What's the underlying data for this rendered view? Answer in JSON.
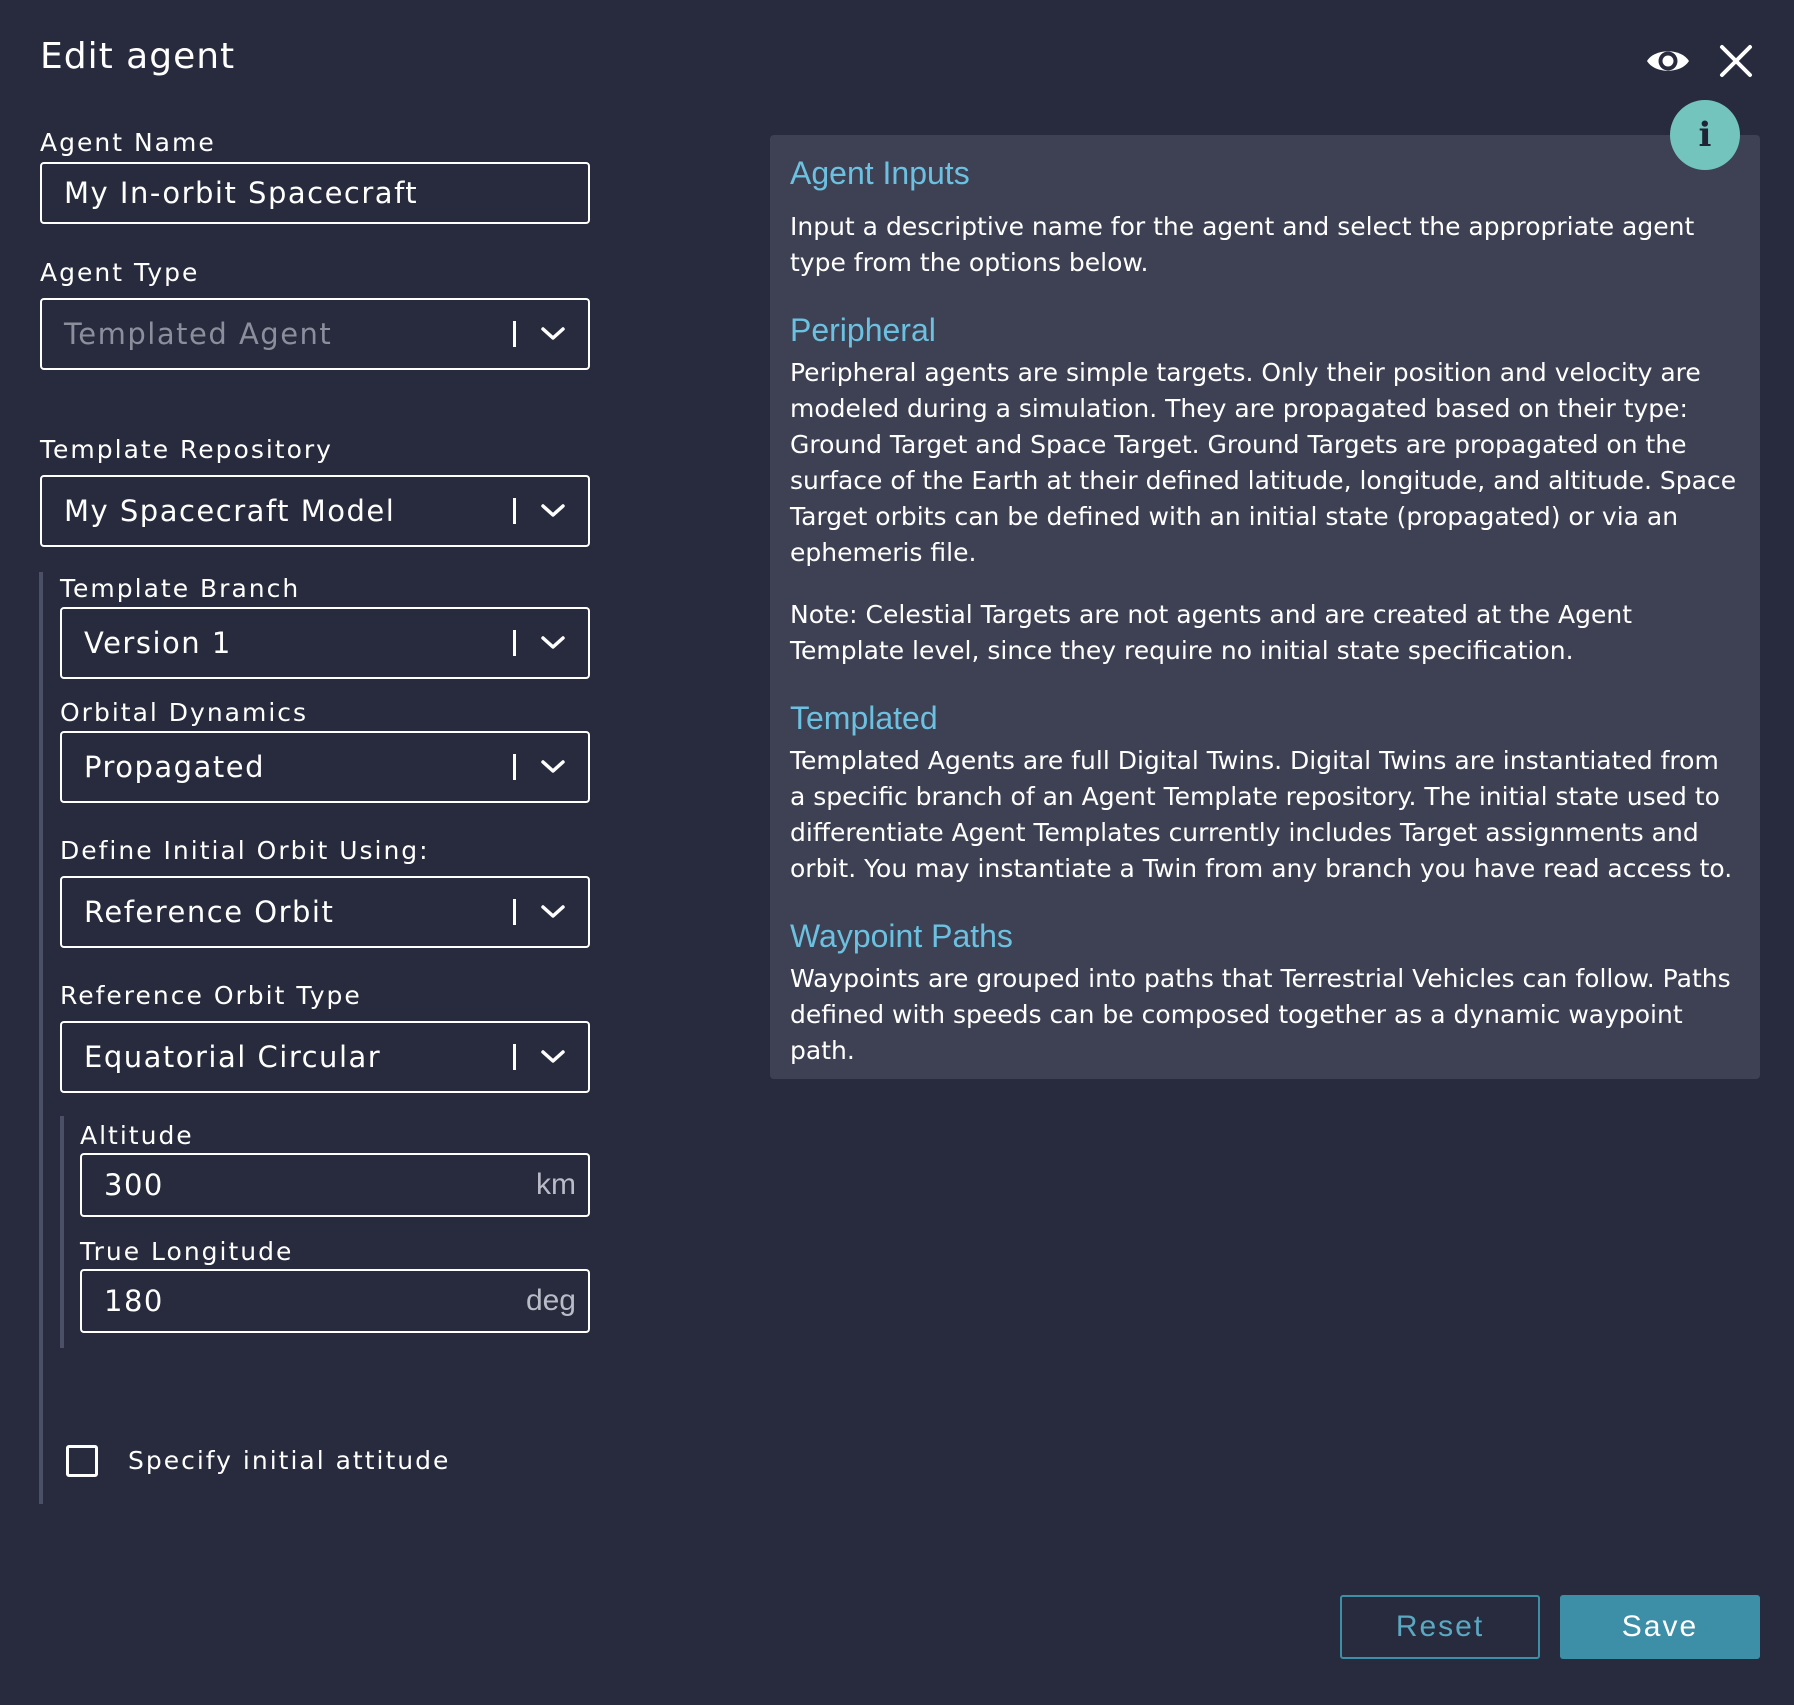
{
  "header": {
    "title": "Edit agent",
    "eye_icon": "eye-icon",
    "close_icon": "close-icon"
  },
  "form": {
    "agent_name": {
      "label": "Agent Name",
      "value": "My In-orbit Spacecraft"
    },
    "agent_type": {
      "label": "Agent Type",
      "value": "Templated Agent",
      "disabled": true
    },
    "template_repository": {
      "label": "Template Repository",
      "value": "My Spacecraft Model"
    },
    "template_branch": {
      "label": "Template Branch",
      "value": "Version 1"
    },
    "orbital_dynamics": {
      "label": "Orbital Dynamics",
      "value": "Propagated"
    },
    "define_initial_orbit": {
      "label": "Define Initial Orbit Using:",
      "value": "Reference Orbit"
    },
    "reference_orbit_type": {
      "label": "Reference Orbit Type",
      "value": "Equatorial Circular"
    },
    "altitude": {
      "label": "Altitude",
      "value": "300",
      "unit": "km"
    },
    "true_longitude": {
      "label": "True Longitude",
      "value": "180",
      "unit": "deg"
    },
    "specify_initial_attitude": {
      "label": "Specify initial attitude",
      "checked": false
    }
  },
  "info": {
    "badge": "i",
    "sections": [
      {
        "heading": "Agent Inputs",
        "paragraphs": [
          "Input a descriptive name for the agent and select the appropriate agent type from the options below."
        ]
      },
      {
        "heading": "Peripheral",
        "paragraphs": [
          "Peripheral agents are simple targets. Only their position and velocity are modeled during a simulation. They are propagated based on their type: Ground Target and Space Target. Ground Targets are propagated on the surface of the Earth at their defined latitude, longitude, and altitude. Space Target orbits can be defined with an initial state (propagated) or via an ephemeris file.",
          "Note: Celestial Targets are not agents and are created at the Agent Template level, since they require no initial state specification."
        ]
      },
      {
        "heading": "Templated",
        "paragraphs": [
          "Templated Agents are full Digital Twins. Digital Twins are instantiated from a specific branch of an Agent Template repository. The initial state used to differentiate Agent Templates currently includes Target assignments and orbit. You may instantiate a Twin from any branch you have read access to."
        ]
      },
      {
        "heading": "Waypoint Paths",
        "paragraphs": [
          "Waypoints are grouped into paths that Terrestrial Vehicles can follow. Paths defined with speeds can be composed together as a dynamic waypoint path."
        ]
      }
    ]
  },
  "footer": {
    "reset_label": "Reset",
    "save_label": "Save"
  },
  "colors": {
    "background": "#272b3d",
    "panel": "#3e4154",
    "heading_accent": "#6cc1e0",
    "primary_button": "#3d8ea7",
    "info_badge": "#73c4bd"
  }
}
